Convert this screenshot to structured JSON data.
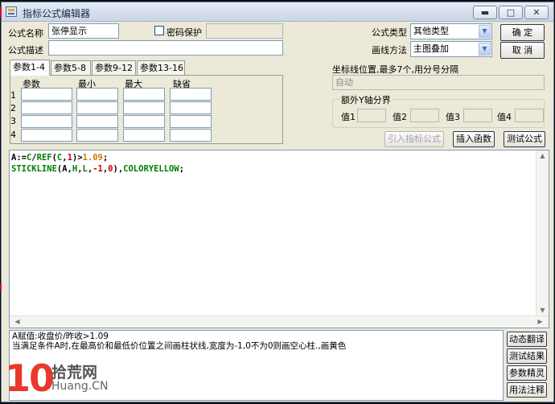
{
  "window": {
    "title": "指标公式编辑器",
    "controls": {
      "minimize": "▬",
      "maximize": "□",
      "close": "✕"
    }
  },
  "formula": {
    "name_label": "公式名称",
    "name_value": "张停显示",
    "password_label": "密码保护",
    "password_checked": false,
    "desc_label": "公式描述",
    "desc_value": "",
    "type_label": "公式类型",
    "type_value": "其他类型",
    "draw_label": "画线方法",
    "draw_value": "主图叠加"
  },
  "buttons": {
    "ok": "确  定",
    "cancel": "取  消",
    "import": "引入指标公式",
    "insert_func": "插入函数",
    "test": "测试公式"
  },
  "params": {
    "tabs": [
      "参数1-4",
      "参数5-8",
      "参数9-12",
      "参数13-16"
    ],
    "active_tab": 0,
    "columns": [
      "参数",
      "最小",
      "最大",
      "缺省"
    ],
    "rows": [
      "1",
      "2",
      "3",
      "4"
    ]
  },
  "axis": {
    "coord_label": "坐标线位置,最多7个,用分号分隔",
    "coord_value": "自动",
    "extra_group": "额外Y轴分界",
    "values": [
      "值1",
      "值2",
      "值3",
      "值4"
    ]
  },
  "code": {
    "line1": [
      {
        "t": "A:=",
        "c": "dark"
      },
      {
        "t": "C",
        "c": "green"
      },
      {
        "t": "/",
        "c": "dark"
      },
      {
        "t": "REF",
        "c": "green"
      },
      {
        "t": "(",
        "c": "dark"
      },
      {
        "t": "C",
        "c": "green"
      },
      {
        "t": ",",
        "c": "dark"
      },
      {
        "t": "1",
        "c": "red"
      },
      {
        "t": ")>",
        "c": "dark"
      },
      {
        "t": "1.09",
        "c": "orange"
      },
      {
        "t": ";",
        "c": "dark"
      }
    ],
    "line2": [
      {
        "t": "STICKLINE",
        "c": "green"
      },
      {
        "t": "(A,",
        "c": "dark"
      },
      {
        "t": "H",
        "c": "green"
      },
      {
        "t": ",",
        "c": "dark"
      },
      {
        "t": "L",
        "c": "green"
      },
      {
        "t": ",",
        "c": "dark"
      },
      {
        "t": "-1",
        "c": "red"
      },
      {
        "t": ",",
        "c": "dark"
      },
      {
        "t": "0",
        "c": "red"
      },
      {
        "t": "),",
        "c": "dark"
      },
      {
        "t": "COLORYELLOW",
        "c": "green"
      },
      {
        "t": ";",
        "c": "dark"
      }
    ]
  },
  "description": {
    "line1": "A赋值:收盘价/昨收>1.09",
    "line2": "当满足条件A时,在最高价和最低价位置之间画柱状线,宽度为-1,0不为0则画空心柱.,画黄色"
  },
  "side_buttons": [
    "动态翻译",
    "测试结果",
    "参数精灵",
    "用法注释"
  ],
  "watermark": {
    "digits": "10",
    "name": "拾荒网",
    "site": "Huang.CN"
  },
  "colors": {
    "window_bg": "#ece9d8",
    "code_green": "#007f00",
    "code_red": "#cc0000",
    "code_orange": "#d07a00",
    "watermark_red": "#e8392d"
  }
}
